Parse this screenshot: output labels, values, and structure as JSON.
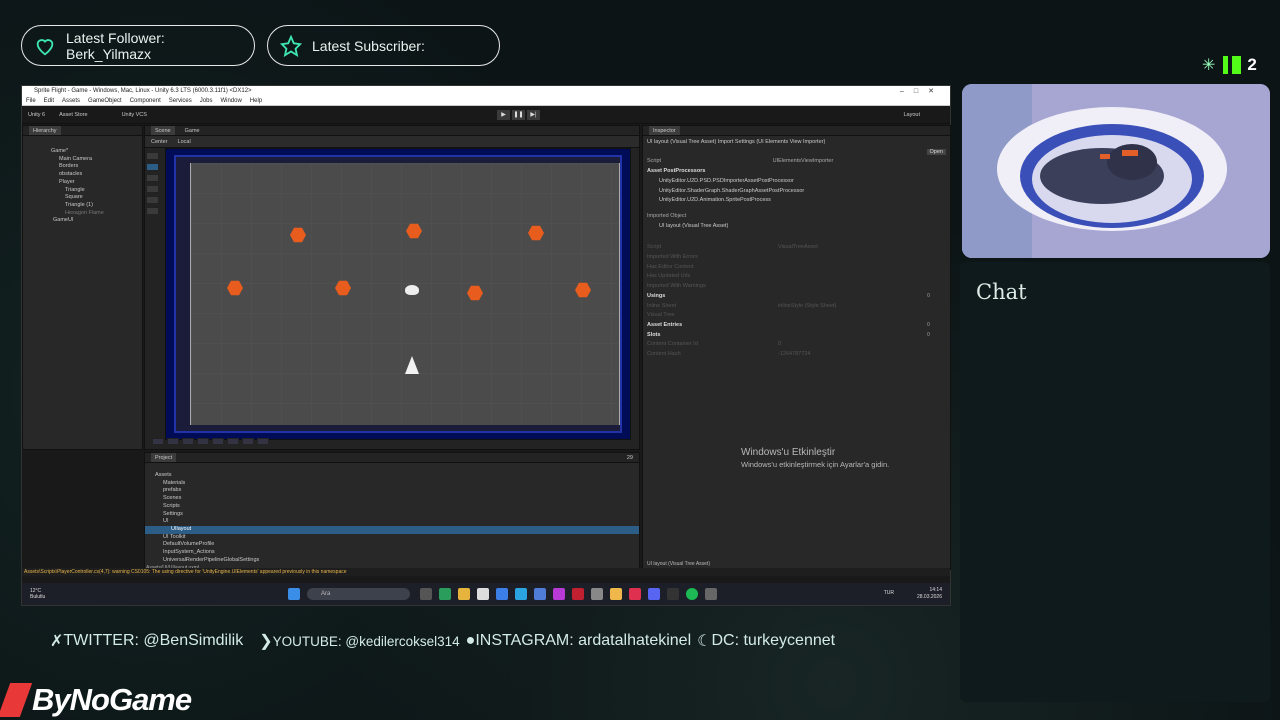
{
  "overlay": {
    "follower_label": "Latest Follower:",
    "follower_name": "Berk_Yilmazx",
    "subscriber_label": "Latest Subscriber:",
    "kick_count": "2",
    "chat_title": "Chat",
    "socials": {
      "twitter": "TWITTER: @BenSimdilik",
      "youtube": "YOUTUBE: @kedilercoksel314",
      "instagram": "INSTAGRAM: ardatalhatekinel",
      "discord": "DC: turkeycennet"
    },
    "logo": "ByNoGame"
  },
  "unity": {
    "window_title": "Sprite Flight - Game - Windows, Mac, Linux - Unity 6.3 LTS (6000.3.11f1) <DX12>",
    "menu": [
      "File",
      "Edit",
      "Assets",
      "GameObject",
      "Component",
      "Services",
      "Jobs",
      "Window",
      "Help"
    ],
    "toolbar": {
      "account": "Unity 6",
      "asset_store": "Asset Store",
      "vcs": "Unity VCS",
      "layout": "Layout"
    },
    "hierarchy_tab": "Hierarchy",
    "hierarchy": [
      "Game*",
      "Main Camera",
      "Borders",
      "obstacles",
      "Player",
      "Triangle",
      "Square",
      "Triangle (1)",
      "Hexagon Flame",
      "GameUI"
    ],
    "scene_tab": "Scene",
    "game_tab": "Game",
    "pivot": "Center",
    "space": "Local",
    "project_tab": "Project",
    "project_tree": [
      "Assets",
      "Materials",
      "prefabs",
      "Scenes",
      "Scripts",
      "Settings",
      "UI",
      "UIlayout",
      "UI Toolkit",
      "DefaultVolumeProfile",
      "InputSystem_Actions",
      "UniversalRenderPipelineGlobalSettings"
    ],
    "project_count": "29",
    "project_path": "Assets/UI/UIlayout.uxml",
    "inspector_tab": "Inspector",
    "inspector": {
      "header": "UI layout (Visual Tree Asset) Import Settings (UI Elements View Importer)",
      "open_button": "Open",
      "script_label": "Script",
      "script_value": "UIElementsViewImporter",
      "postprocessors_label": "Asset PostProcessors",
      "postprocessors": [
        "UnityEditor.U2D.PSD.PSDImporterAssetPostProcessor",
        "UnityEditor.ShaderGraph.ShaderGraphAssetPostProcessor",
        "UnityEditor.U2D.Animation.SpritePostProcess"
      ],
      "imported_object": "Imported Object",
      "object_title": "UI layout (Visual Tree Asset)",
      "fields": [
        {
          "label": "Script",
          "value": "VisualTreeAsset"
        },
        {
          "label": "Imported With Errors",
          "value": ""
        },
        {
          "label": "Has Editor Content",
          "value": ""
        },
        {
          "label": "Has Updated Urls",
          "value": ""
        },
        {
          "label": "Imported With Warnings",
          "value": ""
        },
        {
          "label": "Usings",
          "value": "0"
        },
        {
          "label": "Inline Sheet",
          "value": "inlineStyle (Style Sheet)"
        },
        {
          "label": "Visual Tree",
          "value": ""
        },
        {
          "label": "Asset Entries",
          "value": "0"
        },
        {
          "label": "Slots",
          "value": "0"
        },
        {
          "label": "Content Container Id",
          "value": "0"
        },
        {
          "label": "Content Hash",
          "value": "-1264787724"
        }
      ],
      "footer": "UI layout (Visual Tree Asset)"
    },
    "status_warning": "Assets\\Scripts\\PlayerController.cs(4,7): warning CS0105: The using directive for 'UnityEngine.UIElements' appeared previously in this namespace"
  },
  "taskbar": {
    "weather_temp": "12°C",
    "weather_desc": "Bulutlu",
    "search_placeholder": "Ara",
    "lang": "TUR",
    "time": "14:14",
    "date": "28.03.2026"
  },
  "activation": {
    "title": "Windows'u Etkinleştir",
    "subtitle": "Windows'u etkinleştirmek için Ayarlar'a gidin."
  }
}
